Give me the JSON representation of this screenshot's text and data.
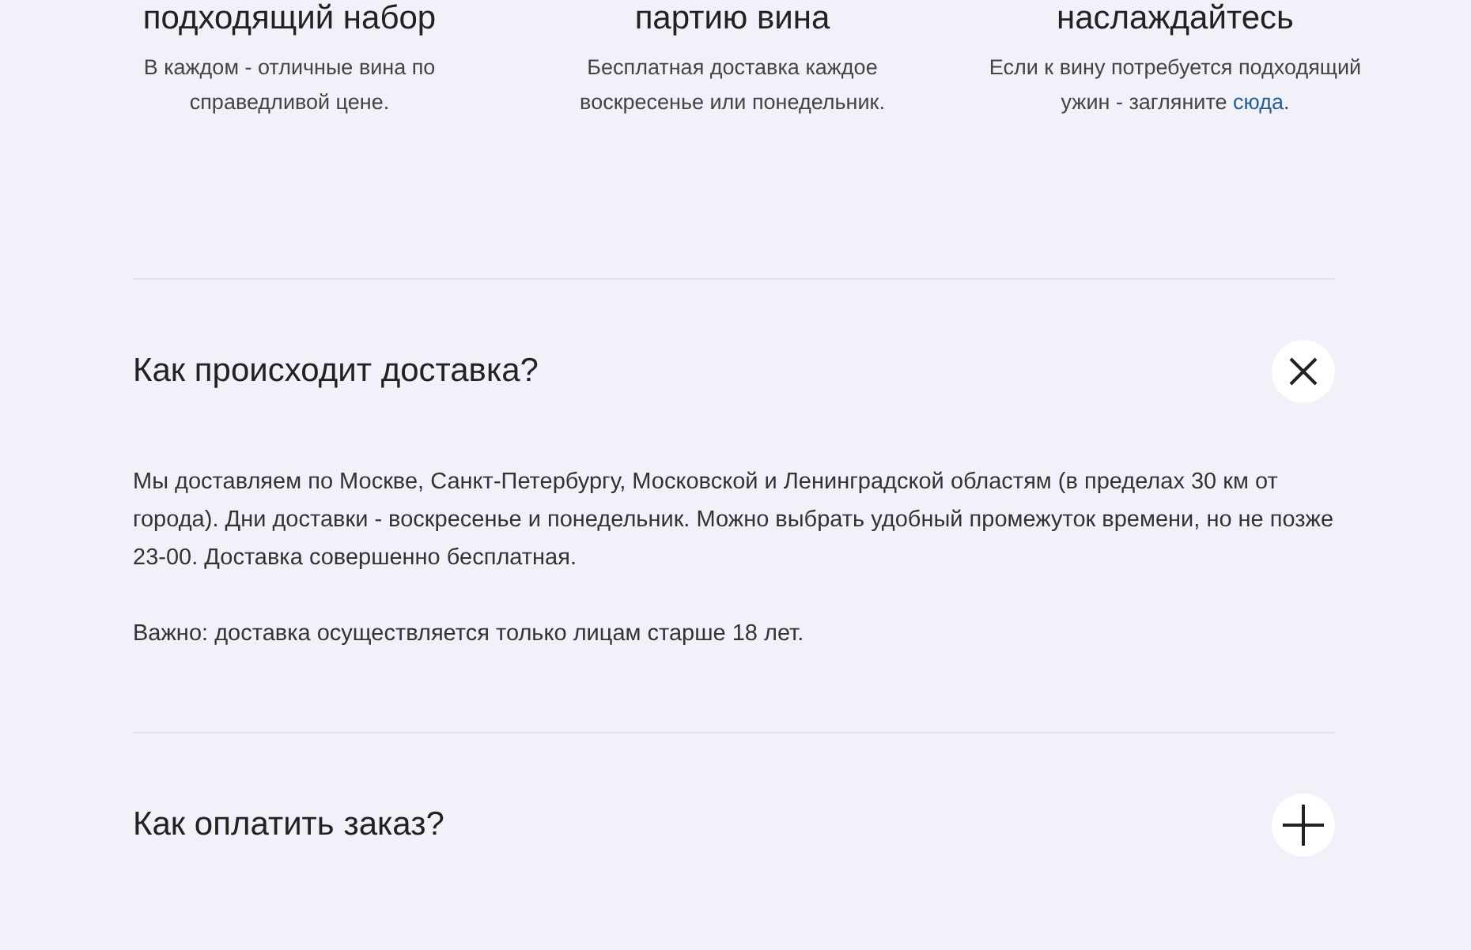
{
  "steps": [
    {
      "title": "подходящий набор",
      "description": "В каждом - отличные вина по справедливой цене."
    },
    {
      "title": "партию вина",
      "description": "Бесплатная доставка каждое воскресенье или понедельник."
    },
    {
      "title": "наслаждайтесь",
      "description": "Если к вину потребуется подходящий ужин - загляните ",
      "link": "сюда",
      "after": "."
    }
  ],
  "faq": [
    {
      "question": "Как происходит доставка?",
      "expanded": true,
      "answer": [
        "Мы доставляем по Москве, Санкт-Петербургу, Московской и Ленинградской областям (в пределах 30 км от города). Дни доставки - воскресенье и понедельник. Можно выбрать удобный промежуток времени, но не позже 23-00. Доставка совершенно бесплатная.",
        "Важно: доставка осуществляется только лицам старше 18 лет."
      ]
    },
    {
      "question": "Как оплатить заказ?",
      "expanded": false
    }
  ]
}
